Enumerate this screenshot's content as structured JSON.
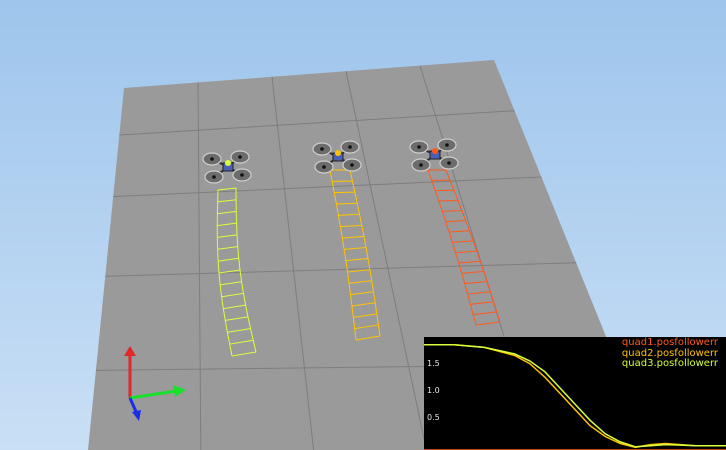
{
  "colors": {
    "sky_top": "#9ec5ec",
    "sky_bottom": "#c9dff5",
    "ground": "#9a9a9a",
    "grid_line": "#7e7e7e",
    "quad1": "#ff5a1e",
    "quad2": "#ffc300",
    "quad3": "#d8ff3a",
    "axis_x": "#19e02a",
    "axis_y": "#e2262a",
    "axis_z": "#1a2ee6",
    "graph_bg": "#000000"
  },
  "quadrotors": [
    {
      "name": "quad1",
      "color": "#ff5a1e"
    },
    {
      "name": "quad2",
      "color": "#ffc300"
    },
    {
      "name": "quad3",
      "color": "#d8ff3a"
    }
  ],
  "graph": {
    "ticks": [
      "1.5",
      "1.0",
      "0.5"
    ],
    "legend": [
      {
        "label": "quad1.posfollowerr",
        "color": "#ff5a1e"
      },
      {
        "label": "quad2.posfollowerr",
        "color": "#ffc300"
      },
      {
        "label": "quad3.posfollowerr",
        "color": "#d8ff3a"
      }
    ]
  },
  "chart_data": {
    "type": "line",
    "title": "",
    "ylim": [
      0,
      2.0
    ],
    "yticks": [
      0.5,
      1.0,
      1.5
    ],
    "series": [
      {
        "name": "quad1.posfollowerr",
        "color": "#ff5a1e",
        "x": [
          0,
          0.1,
          0.2,
          0.3,
          0.35,
          0.4,
          0.45,
          0.5,
          0.55,
          0.6,
          0.65,
          0.7,
          0.75,
          0.8,
          0.85,
          0.9,
          1.0
        ],
        "y": [
          0.0,
          0.0,
          0.0,
          0.0,
          0.0,
          0.0,
          0.0,
          0.0,
          0.0,
          0.0,
          0.0,
          0.0,
          0.0,
          0.0,
          0.0,
          0.0,
          0.0
        ]
      },
      {
        "name": "quad2.posfollowerr",
        "color": "#ffc300",
        "x": [
          0,
          0.1,
          0.2,
          0.3,
          0.35,
          0.4,
          0.45,
          0.5,
          0.55,
          0.6,
          0.65,
          0.7,
          0.75,
          0.8,
          0.85,
          0.9,
          1.0
        ],
        "y": [
          1.95,
          1.95,
          1.9,
          1.75,
          1.6,
          1.35,
          1.05,
          0.75,
          0.45,
          0.25,
          0.12,
          0.05,
          0.1,
          0.12,
          0.1,
          0.08,
          0.08
        ]
      },
      {
        "name": "quad3.posfollowerr",
        "color": "#d8ff3a",
        "x": [
          0,
          0.1,
          0.2,
          0.3,
          0.35,
          0.4,
          0.45,
          0.5,
          0.55,
          0.6,
          0.65,
          0.7,
          0.75,
          0.8,
          0.85,
          0.9,
          1.0
        ],
        "y": [
          1.95,
          1.95,
          1.9,
          1.78,
          1.65,
          1.45,
          1.15,
          0.85,
          0.55,
          0.3,
          0.15,
          0.06,
          0.08,
          0.1,
          0.09,
          0.08,
          0.08
        ]
      }
    ]
  }
}
